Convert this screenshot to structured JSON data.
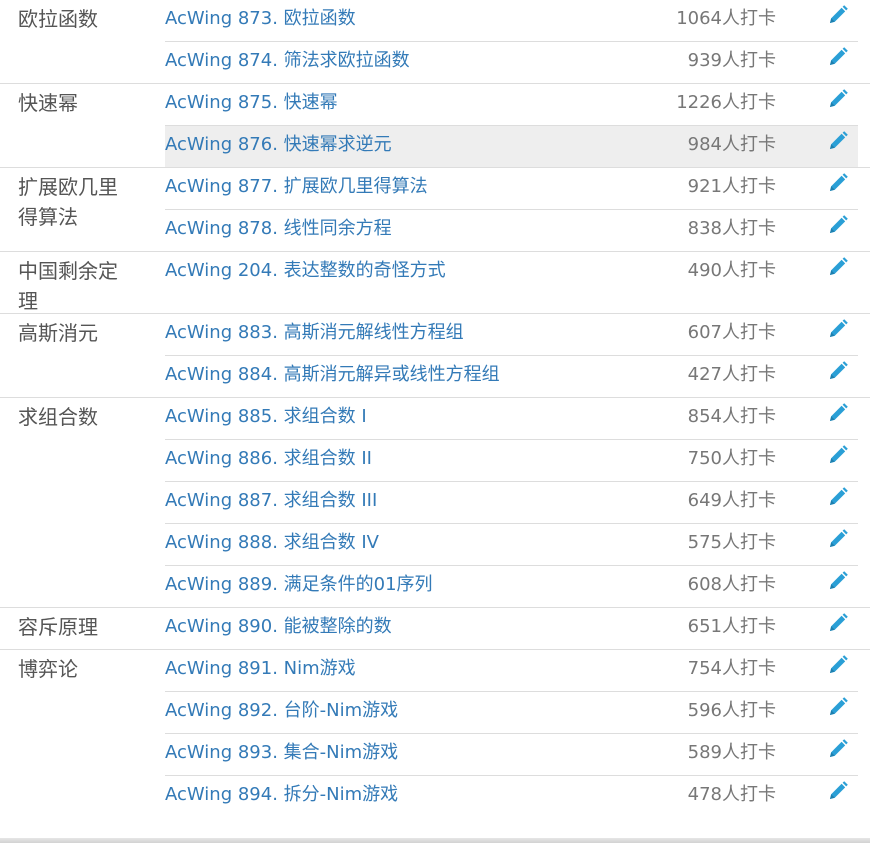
{
  "colors": {
    "link": "#337ab7",
    "count": "#777777",
    "category": "#555555",
    "highlight": "#eeeeee",
    "divider": "#dddddd"
  },
  "icons": {
    "edit": "pencil-icon"
  },
  "groups": [
    {
      "category": "欧拉函数",
      "problems": [
        {
          "title": "AcWing 873. 欧拉函数",
          "count": "1064人打卡"
        },
        {
          "title": "AcWing 874. 筛法求欧拉函数",
          "count": "939人打卡"
        }
      ]
    },
    {
      "category": "快速幂",
      "problems": [
        {
          "title": "AcWing 875. 快速幂",
          "count": "1226人打卡"
        },
        {
          "title": "AcWing 876. 快速幂求逆元",
          "count": "984人打卡",
          "highlighted": true
        }
      ]
    },
    {
      "category": "扩展欧几里得算法",
      "problems": [
        {
          "title": "AcWing 877. 扩展欧几里得算法",
          "count": "921人打卡"
        },
        {
          "title": "AcWing 878. 线性同余方程",
          "count": "838人打卡"
        }
      ]
    },
    {
      "category": "中国剩余定理",
      "problems": [
        {
          "title": "AcWing 204. 表达整数的奇怪方式",
          "count": "490人打卡"
        }
      ]
    },
    {
      "category": "高斯消元",
      "problems": [
        {
          "title": "AcWing 883. 高斯消元解线性方程组",
          "count": "607人打卡"
        },
        {
          "title": "AcWing 884. 高斯消元解异或线性方程组",
          "count": "427人打卡"
        }
      ]
    },
    {
      "category": "求组合数",
      "problems": [
        {
          "title": "AcWing 885. 求组合数 I",
          "count": "854人打卡"
        },
        {
          "title": "AcWing 886. 求组合数 II",
          "count": "750人打卡"
        },
        {
          "title": "AcWing 887. 求组合数 III",
          "count": "649人打卡"
        },
        {
          "title": "AcWing 888. 求组合数 IV",
          "count": "575人打卡"
        },
        {
          "title": "AcWing 889. 满足条件的01序列",
          "count": "608人打卡"
        }
      ]
    },
    {
      "category": "容斥原理",
      "problems": [
        {
          "title": "AcWing 890. 能被整除的数",
          "count": "651人打卡"
        }
      ]
    },
    {
      "category": "博弈论",
      "problems": [
        {
          "title": "AcWing 891. Nim游戏",
          "count": "754人打卡"
        },
        {
          "title": "AcWing 892. 台阶-Nim游戏",
          "count": "596人打卡"
        },
        {
          "title": "AcWing 893. 集合-Nim游戏",
          "count": "589人打卡"
        },
        {
          "title": "AcWing 894. 拆分-Nim游戏",
          "count": "478人打卡"
        }
      ]
    }
  ]
}
